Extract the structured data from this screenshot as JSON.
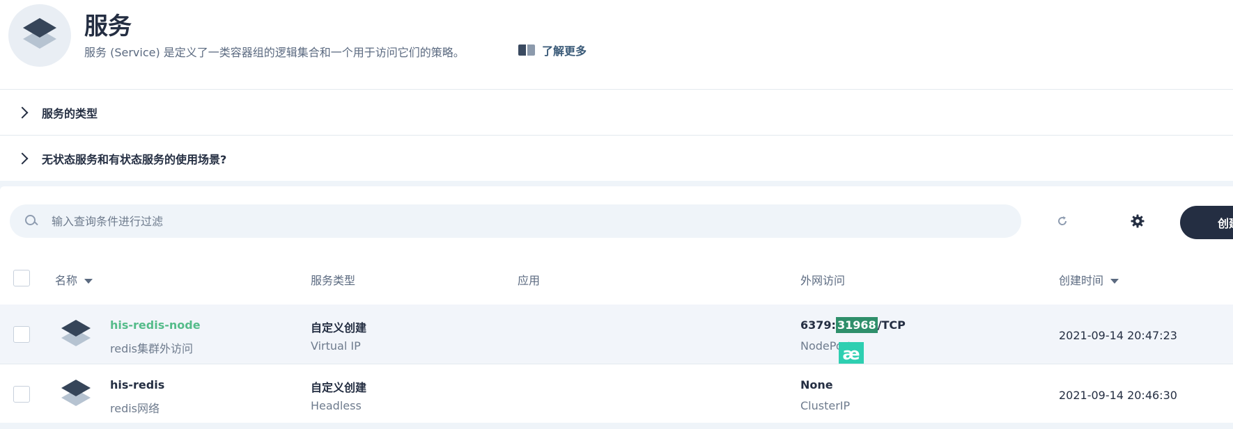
{
  "header": {
    "title": "服务",
    "description": "服务 (Service) 是定义了一类容器组的逻辑集合和一个用于访问它们的策略。",
    "learn_more": "了解更多"
  },
  "collapsibles": [
    {
      "label": "服务的类型"
    },
    {
      "label": "无状态服务和有状态服务的使用场景?"
    }
  ],
  "toolbar": {
    "search_placeholder": "输入查询条件进行过滤",
    "create_label": "创建"
  },
  "table": {
    "columns": {
      "name": "名称",
      "service_type": "服务类型",
      "app": "应用",
      "external_access": "外网访问",
      "created_time": "创建时间"
    },
    "rows": [
      {
        "name": "his-redis-node",
        "description": "redis集群外访问",
        "type_main": "自定义创建",
        "type_sub": "Virtual IP",
        "app": "",
        "access_prefix": "6379:",
        "access_port": "31968",
        "access_suffix": "/TCP",
        "access_sub": "NodePort",
        "created": "2021-09-14 20:47:23"
      },
      {
        "name": "his-redis",
        "description": "redis网络",
        "type_main": "自定义创建",
        "type_sub": "Headless",
        "app": "",
        "access_main": "None",
        "access_sub": "ClusterIP",
        "created": "2021-09-14 20:46:30"
      }
    ]
  },
  "overlay": {
    "badge_text": "æ"
  },
  "colors": {
    "primary_dark": "#242e42",
    "accent_green": "#55bc8a",
    "highlight_green": "#2f8f6b",
    "badge_teal": "#2ecfb1",
    "page_bg": "#eff4f9"
  }
}
